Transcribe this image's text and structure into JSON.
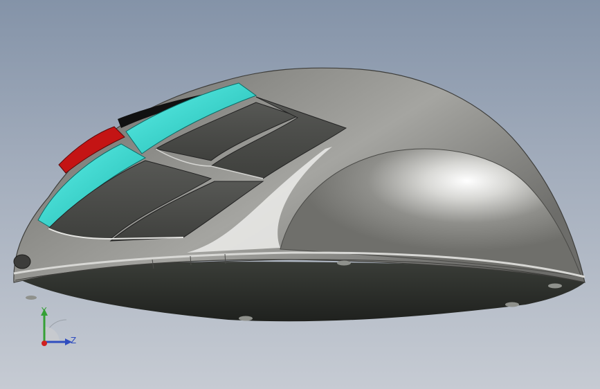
{
  "viewport": {
    "background_top": "#8493a8",
    "background_bottom": "#c6cbd3"
  },
  "model": {
    "shell_color": "#8a8a86",
    "highlight_color": "#f2f2f0",
    "base_color": "#2a2d29",
    "button_color": "#4c4d4a",
    "accent_cyan": "#2ad0c8",
    "accent_red": "#c41414",
    "accent_black": "#111111"
  },
  "triad": {
    "y_label": "Y",
    "z_label": "Z",
    "y_color": "#35a035",
    "z_color": "#2f4dbf",
    "x_color": "#d02020"
  }
}
